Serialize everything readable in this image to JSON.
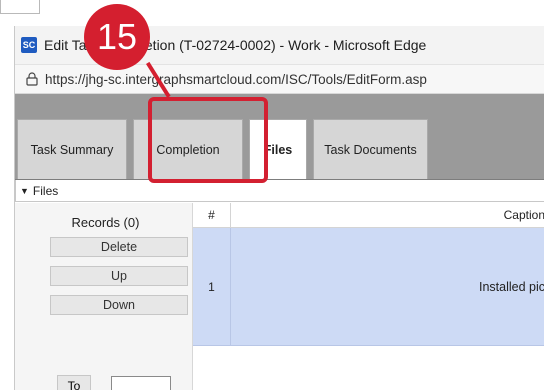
{
  "window": {
    "app_logo": "SC",
    "title": "Edit Task Completion (T-02724-0002) - Work - Microsoft Edge"
  },
  "addressbar": {
    "url": "https://jhg-sc.intergraphsmartcloud.com/ISC/Tools/EditForm.asp"
  },
  "tabs": [
    {
      "label": "Task Summary"
    },
    {
      "label": "Completion"
    },
    {
      "label": "Files"
    },
    {
      "label": "Task Documents"
    }
  ],
  "section": {
    "title": "Files"
  },
  "records": {
    "label": "Records (0)",
    "delete_label": "Delete",
    "up_label": "Up",
    "down_label": "Down",
    "to_label": "To"
  },
  "grid": {
    "columns": {
      "num": "#",
      "caption": "Caption"
    },
    "rows": [
      {
        "num": "1",
        "caption": "Installed pic"
      }
    ]
  },
  "annotation": {
    "step": "15",
    "color": "#d32031"
  }
}
